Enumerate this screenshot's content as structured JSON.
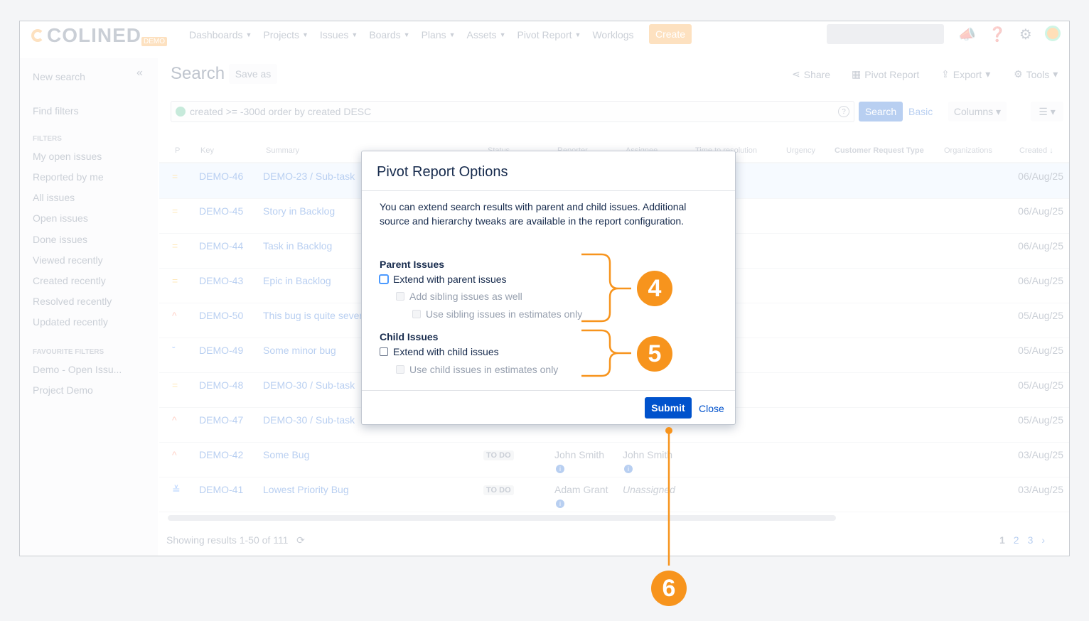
{
  "nav": {
    "logo_text": "COLINED",
    "logo_badge": "DEMO",
    "items": [
      "Dashboards",
      "Projects",
      "Issues",
      "Boards",
      "Plans",
      "Assets",
      "Pivot Report",
      "Worklogs"
    ],
    "create_label": "Create"
  },
  "sidebar": {
    "new_search": "New search",
    "find_filters": "Find filters",
    "filters_heading": "FILTERS",
    "filters": [
      "My open issues",
      "Reported by me",
      "All issues",
      "Open issues",
      "Done issues",
      "Viewed recently",
      "Created recently",
      "Resolved recently",
      "Updated recently"
    ],
    "favourite_heading": "FAVOURITE FILTERS",
    "favourites": [
      "Demo - Open Issu...",
      "Project Demo"
    ]
  },
  "main": {
    "title": "Search",
    "save_as": "Save as",
    "actions": {
      "share": "Share",
      "pivot_report": "Pivot Report",
      "export": "Export",
      "tools": "Tools"
    },
    "jql": "created >= -300d order by created DESC",
    "jql_help": "?",
    "search_button": "Search",
    "basic_link": "Basic",
    "columns_button": "Columns"
  },
  "table": {
    "headers": {
      "p": "P",
      "key": "Key",
      "summary": "Summary",
      "status": "Status",
      "reporter": "Reporter",
      "assignee": "Assignee",
      "time": "Time to resolution",
      "urgency": "Urgency",
      "crt": "Customer Request Type",
      "orgs": "Organizations",
      "created": "Created"
    },
    "rows": [
      {
        "prio": "=",
        "key": "DEMO-46",
        "summary": "DEMO-23 /  Sub-task",
        "status": "",
        "reporter": "",
        "assignee": "",
        "created": "06/Aug/25"
      },
      {
        "prio": "=",
        "key": "DEMO-45",
        "summary": "Story in Backlog",
        "status": "",
        "reporter": "",
        "assignee": "",
        "created": "06/Aug/25"
      },
      {
        "prio": "=",
        "key": "DEMO-44",
        "summary": "Task in Backlog",
        "status": "",
        "reporter": "",
        "assignee": "",
        "created": "06/Aug/25"
      },
      {
        "prio": "=",
        "key": "DEMO-43",
        "summary": "Epic in Backlog",
        "status": "",
        "reporter": "",
        "assignee": "",
        "created": "06/Aug/25"
      },
      {
        "prio": "^",
        "key": "DEMO-50",
        "summary": "This bug is quite severe",
        "status": "",
        "reporter": "",
        "assignee": "",
        "created": "05/Aug/25"
      },
      {
        "prio": "ˇ",
        "key": "DEMO-49",
        "summary": "Some minor bug",
        "status": "",
        "reporter": "",
        "assignee": "",
        "created": "05/Aug/25"
      },
      {
        "prio": "=",
        "key": "DEMO-48",
        "summary": "DEMO-30 /  Sub-task",
        "status": "",
        "reporter": "",
        "assignee": "",
        "created": "05/Aug/25"
      },
      {
        "prio": "^",
        "key": "DEMO-47",
        "summary": "DEMO-30 /  Sub-task",
        "status": "",
        "reporter": "",
        "assignee": "",
        "created": "05/Aug/25"
      },
      {
        "prio": "^",
        "key": "DEMO-42",
        "summary": "Some Bug",
        "status": "TO DO",
        "reporter": "John Smith",
        "assignee": "John Smith",
        "created": "03/Aug/25"
      },
      {
        "prio": "≚",
        "key": "DEMO-41",
        "summary": "Lowest Priority Bug",
        "status": "TO DO",
        "reporter": "Adam Grant",
        "assignee": "Unassigned",
        "created": "03/Aug/25"
      }
    ],
    "info_glyph": "i",
    "results_text": "Showing results 1-50 of 111",
    "pages": [
      "1",
      "2",
      "3",
      "›"
    ]
  },
  "modal": {
    "title": "Pivot Report Options",
    "description": "You can extend search results with parent and child issues. Additional source and hierarchy tweaks are available in the report configuration.",
    "parent_label": "Parent Issues",
    "extend_parent": "Extend with parent issues",
    "add_sibling": "Add sibling issues as well",
    "use_sibling": "Use sibling issues in estimates only",
    "child_label": "Child Issues",
    "extend_child": "Extend with child issues",
    "use_child": "Use child issues in estimates only",
    "submit": "Submit",
    "close": "Close"
  },
  "annotations": {
    "badge_4": "4",
    "badge_5": "5",
    "badge_6": "6",
    "accent_color": "#f7941d"
  }
}
